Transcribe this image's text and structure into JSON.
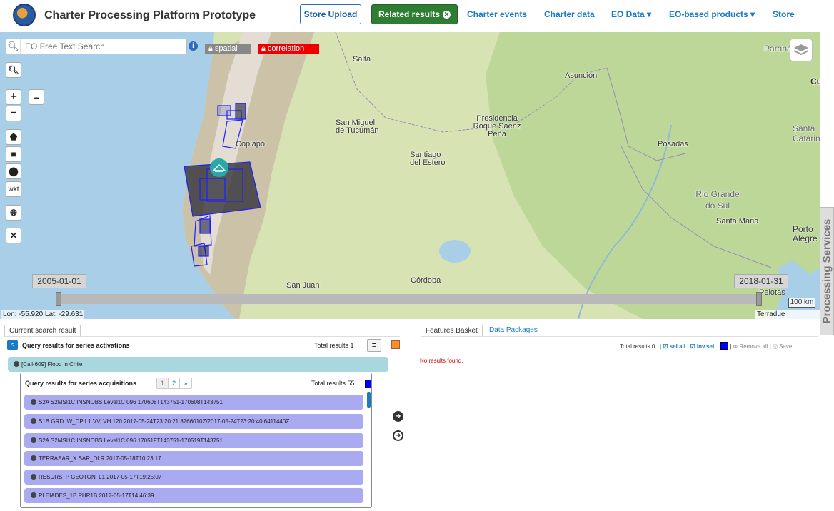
{
  "header": {
    "title": "Charter Processing Platform Prototype",
    "store_upload": "Store Upload",
    "related_results": "Related results",
    "links": [
      "Charter events",
      "Charter data",
      "EO Data ▾",
      "EO-based products ▾",
      "Store"
    ]
  },
  "search": {
    "placeholder": "EO Free Text Search"
  },
  "chips": {
    "spatial": "spatial",
    "correlation": "correlation"
  },
  "map_tools": {
    "wkt": "wkt"
  },
  "map_labels": [
    "Salta",
    "Asunción",
    "San Miguel de Tucumán",
    "Presidencia Roque Sáenz Peña",
    "Santiago del Estero",
    "Copiapó",
    "Posadas",
    "Rio Grande do Sul",
    "Santa Maria",
    "Porto Alegre",
    "San Juan",
    "Córdoba",
    "Pelotas",
    "Paraná",
    "Santa Catarina",
    "Cu"
  ],
  "timeline": {
    "start": "2005-01-01",
    "end": "2018-01-31"
  },
  "scale": "100 km",
  "coords": "Lon: -55.920 Lat: -29.631",
  "attribution": "Terradue | Terradue",
  "side_tab": "Processing Services",
  "left_panel": {
    "tab": "Current search result",
    "query_title": "Query results for series activations",
    "total_results": "Total results  1",
    "activation": "[Call-609] Flood in Chile",
    "acq_title": "Query results for series acquisitions",
    "pager": [
      "1",
      "2",
      "»"
    ],
    "acq_total": "Total results  55",
    "acquisitions": [
      "S2A S2MSI1C INSNOBS Level1C 096 170608T143751-170608T143751",
      "S1B GRD IW_DP L1 VV, VH 120 2017-05-24T23:20:21.8766010Z/2017-05-24T23:20:40.6411440Z",
      "S2A S2MSI1C INSNOBS Level1C 096 170519T143751-170519T143751",
      "TERRASAR_X SAR_DLR 2017-05-18T10:23:17",
      "RESURS_P GEOTON_L1 2017-05-17T19:25:07",
      "PLEIADES_1B PHR1B 2017-05-17T14:46:39"
    ]
  },
  "right_panel": {
    "tab_basket": "Features Basket",
    "tab_packages": "Data Packages",
    "total": "Total results  0",
    "sel_all": "sel.all",
    "inv_sel": "inv.sel.",
    "remove_all": "Remove all",
    "save": "Save",
    "no_results": "No results found."
  },
  "colors": {
    "accent": "#1a7bc4",
    "related_btn": "#2e7d32",
    "correlation": "#ee0000",
    "acq_row": "#aaaaf0",
    "activation_row": "#a8d7e0"
  }
}
